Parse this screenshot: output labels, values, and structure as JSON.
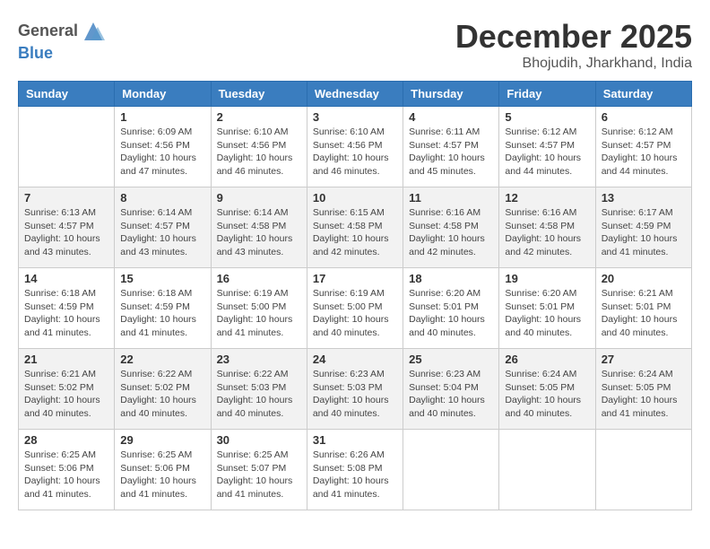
{
  "logo": {
    "general": "General",
    "blue": "Blue"
  },
  "title": "December 2025",
  "location": "Bhojudih, Jharkhand, India",
  "weekdays": [
    "Sunday",
    "Monday",
    "Tuesday",
    "Wednesday",
    "Thursday",
    "Friday",
    "Saturday"
  ],
  "weeks": [
    [
      {
        "day": "",
        "info": ""
      },
      {
        "day": "1",
        "info": "Sunrise: 6:09 AM\nSunset: 4:56 PM\nDaylight: 10 hours\nand 47 minutes."
      },
      {
        "day": "2",
        "info": "Sunrise: 6:10 AM\nSunset: 4:56 PM\nDaylight: 10 hours\nand 46 minutes."
      },
      {
        "day": "3",
        "info": "Sunrise: 6:10 AM\nSunset: 4:56 PM\nDaylight: 10 hours\nand 46 minutes."
      },
      {
        "day": "4",
        "info": "Sunrise: 6:11 AM\nSunset: 4:57 PM\nDaylight: 10 hours\nand 45 minutes."
      },
      {
        "day": "5",
        "info": "Sunrise: 6:12 AM\nSunset: 4:57 PM\nDaylight: 10 hours\nand 44 minutes."
      },
      {
        "day": "6",
        "info": "Sunrise: 6:12 AM\nSunset: 4:57 PM\nDaylight: 10 hours\nand 44 minutes."
      }
    ],
    [
      {
        "day": "7",
        "info": "Sunrise: 6:13 AM\nSunset: 4:57 PM\nDaylight: 10 hours\nand 43 minutes."
      },
      {
        "day": "8",
        "info": "Sunrise: 6:14 AM\nSunset: 4:57 PM\nDaylight: 10 hours\nand 43 minutes."
      },
      {
        "day": "9",
        "info": "Sunrise: 6:14 AM\nSunset: 4:58 PM\nDaylight: 10 hours\nand 43 minutes."
      },
      {
        "day": "10",
        "info": "Sunrise: 6:15 AM\nSunset: 4:58 PM\nDaylight: 10 hours\nand 42 minutes."
      },
      {
        "day": "11",
        "info": "Sunrise: 6:16 AM\nSunset: 4:58 PM\nDaylight: 10 hours\nand 42 minutes."
      },
      {
        "day": "12",
        "info": "Sunrise: 6:16 AM\nSunset: 4:58 PM\nDaylight: 10 hours\nand 42 minutes."
      },
      {
        "day": "13",
        "info": "Sunrise: 6:17 AM\nSunset: 4:59 PM\nDaylight: 10 hours\nand 41 minutes."
      }
    ],
    [
      {
        "day": "14",
        "info": "Sunrise: 6:18 AM\nSunset: 4:59 PM\nDaylight: 10 hours\nand 41 minutes."
      },
      {
        "day": "15",
        "info": "Sunrise: 6:18 AM\nSunset: 4:59 PM\nDaylight: 10 hours\nand 41 minutes."
      },
      {
        "day": "16",
        "info": "Sunrise: 6:19 AM\nSunset: 5:00 PM\nDaylight: 10 hours\nand 41 minutes."
      },
      {
        "day": "17",
        "info": "Sunrise: 6:19 AM\nSunset: 5:00 PM\nDaylight: 10 hours\nand 40 minutes."
      },
      {
        "day": "18",
        "info": "Sunrise: 6:20 AM\nSunset: 5:01 PM\nDaylight: 10 hours\nand 40 minutes."
      },
      {
        "day": "19",
        "info": "Sunrise: 6:20 AM\nSunset: 5:01 PM\nDaylight: 10 hours\nand 40 minutes."
      },
      {
        "day": "20",
        "info": "Sunrise: 6:21 AM\nSunset: 5:01 PM\nDaylight: 10 hours\nand 40 minutes."
      }
    ],
    [
      {
        "day": "21",
        "info": "Sunrise: 6:21 AM\nSunset: 5:02 PM\nDaylight: 10 hours\nand 40 minutes."
      },
      {
        "day": "22",
        "info": "Sunrise: 6:22 AM\nSunset: 5:02 PM\nDaylight: 10 hours\nand 40 minutes."
      },
      {
        "day": "23",
        "info": "Sunrise: 6:22 AM\nSunset: 5:03 PM\nDaylight: 10 hours\nand 40 minutes."
      },
      {
        "day": "24",
        "info": "Sunrise: 6:23 AM\nSunset: 5:03 PM\nDaylight: 10 hours\nand 40 minutes."
      },
      {
        "day": "25",
        "info": "Sunrise: 6:23 AM\nSunset: 5:04 PM\nDaylight: 10 hours\nand 40 minutes."
      },
      {
        "day": "26",
        "info": "Sunrise: 6:24 AM\nSunset: 5:05 PM\nDaylight: 10 hours\nand 40 minutes."
      },
      {
        "day": "27",
        "info": "Sunrise: 6:24 AM\nSunset: 5:05 PM\nDaylight: 10 hours\nand 41 minutes."
      }
    ],
    [
      {
        "day": "28",
        "info": "Sunrise: 6:25 AM\nSunset: 5:06 PM\nDaylight: 10 hours\nand 41 minutes."
      },
      {
        "day": "29",
        "info": "Sunrise: 6:25 AM\nSunset: 5:06 PM\nDaylight: 10 hours\nand 41 minutes."
      },
      {
        "day": "30",
        "info": "Sunrise: 6:25 AM\nSunset: 5:07 PM\nDaylight: 10 hours\nand 41 minutes."
      },
      {
        "day": "31",
        "info": "Sunrise: 6:26 AM\nSunset: 5:08 PM\nDaylight: 10 hours\nand 41 minutes."
      },
      {
        "day": "",
        "info": ""
      },
      {
        "day": "",
        "info": ""
      },
      {
        "day": "",
        "info": ""
      }
    ]
  ]
}
